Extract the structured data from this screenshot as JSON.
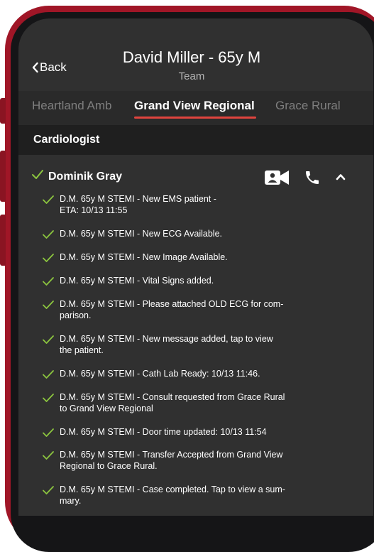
{
  "header": {
    "back_label": "Back",
    "title": "David Miller - 65y M",
    "subtitle": "Team"
  },
  "tabs": [
    {
      "label": "Heartland Amb",
      "active": false
    },
    {
      "label": "Grand View Regional",
      "active": true
    },
    {
      "label": "Grace Rural",
      "active": false
    }
  ],
  "section": {
    "title": "Cardiologist"
  },
  "member": {
    "name": "Dominik Gray",
    "icons": [
      "video-call-icon",
      "phone-icon",
      "chevron-up-icon"
    ]
  },
  "messages": [
    {
      "line1": "D.M. 65y M STEMI - New EMS patient -",
      "line2": "ETA: 10/13  11:55"
    },
    {
      "line1": "D.M. 65y M STEMI - New ECG Available.",
      "line2": ""
    },
    {
      "line1": "D.M. 65y M STEMI - New Image Available.",
      "line2": ""
    },
    {
      "line1": "D.M. 65y M STEMI - Vital Signs added.",
      "line2": ""
    },
    {
      "line1": "D.M. 65y M STEMI - Please attached OLD ECG for com-",
      "line2": "parison."
    },
    {
      "line1": "D.M. 65y M STEMI - New message added, tap to view",
      "line2": "the patient."
    },
    {
      "line1": "D.M. 65y M STEMI - Cath Lab Ready: 10/13 11:46.",
      "line2": ""
    },
    {
      "line1": "D.M. 65y M STEMI - Consult requested from Grace Rural",
      "line2": "to Grand View Regional"
    },
    {
      "line1": "D.M. 65y M STEMI - Door time updated: 10/13 11:54",
      "line2": ""
    },
    {
      "line1": "D.M. 65y M STEMI - Transfer Accepted from Grand View",
      "line2": "Regional to Grace Rural."
    },
    {
      "line1": "D.M. 65y M STEMI - Case completed. Tap to view a sum-",
      "line2": "mary."
    }
  ],
  "colors": {
    "accent": "#e0443e",
    "check": "#8cc63f",
    "frame": "#a01627",
    "background": "#303030"
  }
}
